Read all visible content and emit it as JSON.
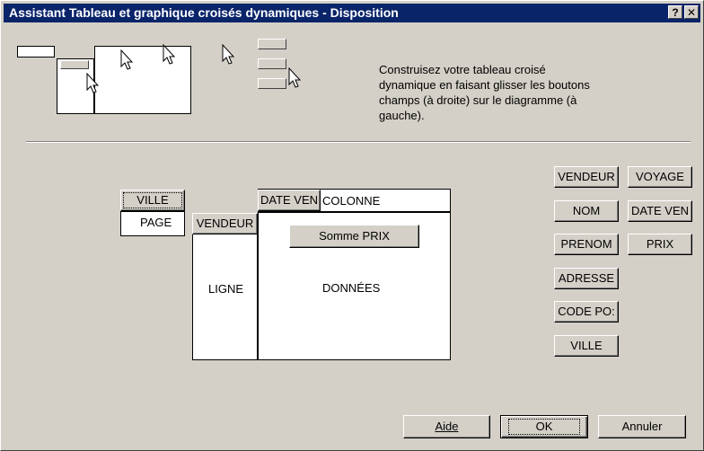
{
  "window": {
    "title": "Assistant Tableau et graphique croisés dynamiques - Disposition"
  },
  "titlebar_buttons": {
    "help": "?",
    "close": "✕"
  },
  "instructions": "Construisez votre tableau croisé dynamique en faisant glisser les boutons champs (à droite) sur le diagramme (à gauche).",
  "layout": {
    "page_zone_label": "PAGE",
    "row_zone_label": "LIGNE",
    "column_zone_label": "COLONNE",
    "data_zone_label": "DONNÉES",
    "page_field": "VILLE",
    "row_field": "VENDEUR",
    "column_field": "DATE VEN",
    "data_field": "Somme PRIX"
  },
  "fields": {
    "vendeur": "VENDEUR",
    "voyage": "VOYAGE",
    "nom": "NOM",
    "date_vente": "DATE VEN",
    "prenom": "PRENOM",
    "prix": "PRIX",
    "adresse": "ADRESSE",
    "code_postal": "CODE PO:",
    "ville": "VILLE"
  },
  "buttons": {
    "aide": "Aide",
    "ok": "OK",
    "annuler": "Annuler"
  },
  "colors": {
    "titlebar": "#0a246a",
    "face": "#d4d0c8"
  }
}
